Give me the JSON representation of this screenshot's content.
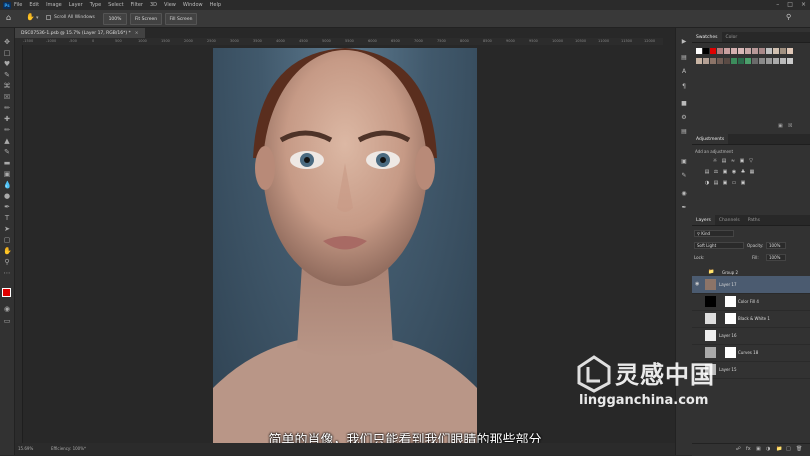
{
  "menu": {
    "app_icon": "Ps",
    "items": [
      "File",
      "Edit",
      "Image",
      "Layer",
      "Type",
      "Select",
      "Filter",
      "3D",
      "View",
      "Window",
      "Help"
    ]
  },
  "options": {
    "scroll_all_windows": "Scroll All Windows",
    "zoom": "100%",
    "fit_screen": "Fit Screen",
    "fill_screen": "Fill Screen"
  },
  "document": {
    "tab_title": "DSC07536-1.psb @ 15.7% (Layer 17, RGB/16*) *"
  },
  "ruler": {
    "ticks": [
      "-1500",
      "-1000",
      "-500",
      "0",
      "500",
      "1000",
      "1500",
      "2000",
      "2500",
      "3000",
      "3500",
      "4000",
      "4500",
      "5000",
      "5500",
      "6000",
      "6500",
      "7000",
      "7500",
      "8000",
      "8500",
      "9000",
      "9500",
      "10000",
      "10500",
      "11000",
      "11500",
      "12000"
    ]
  },
  "status": {
    "zoom": "15.69%",
    "efficiency": "Efficiency: 100%*"
  },
  "subtitle": "简单的肖像，我们只能看到我们眼睛的那些部分",
  "swatches_panel": {
    "tabs": [
      "Swatches",
      "Color"
    ],
    "colors": [
      "#ffffff",
      "#000000",
      "#e00000",
      "#b08080",
      "#c9a0a0",
      "#d4b0b0",
      "#d8b8b8",
      "#c8a8a8",
      "#b89898",
      "#a88888",
      "#c0c0c0",
      "#d0c0b0",
      "#a09080",
      "#e0c8b8",
      "#c8b4a4",
      "#b4a094",
      "#8c7468",
      "#705c54",
      "#5a4a44",
      "#3c8c5c",
      "#2c6c4c",
      "#4ca06c",
      "#6a6a6a",
      "#8a8a8a",
      "#9a9a9a",
      "#aaaaaa",
      "#bababa",
      "#cacaca"
    ]
  },
  "adjustments_panel": {
    "tabs": [
      "Adjustments"
    ],
    "add_label": "Add an adjustment"
  },
  "layers_panel": {
    "tabs": [
      "Layers",
      "Channels",
      "Paths"
    ],
    "kind": "Kind",
    "blend_mode": "Soft Light",
    "opacity_label": "Opacity:",
    "opacity_value": "100%",
    "lock_label": "Lock:",
    "fill_label": "Fill:",
    "fill_value": "100%",
    "layers": [
      {
        "name": "Group 2"
      },
      {
        "name": "Layer 17"
      },
      {
        "name": "Color Fill 4"
      },
      {
        "name": "Black & White 1"
      },
      {
        "name": "Layer 16"
      },
      {
        "name": "Curves 18"
      },
      {
        "name": "Layer 15"
      }
    ]
  },
  "watermark": {
    "cn": "灵感中国",
    "url": "lingganchina.com"
  },
  "colors": {
    "accent": "#31a8ff",
    "selected_layer": "#4b5b70",
    "foreground_swatch": "#e00000"
  }
}
